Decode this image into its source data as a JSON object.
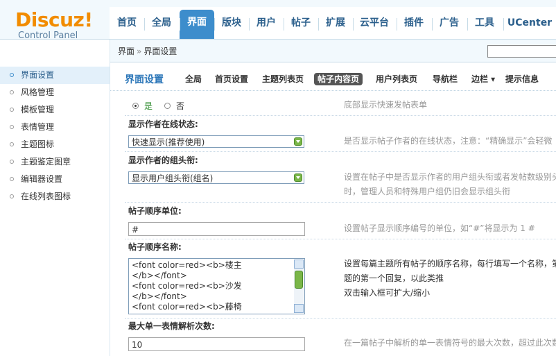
{
  "logo": {
    "brand": "Discuz!",
    "sub": "Control Panel"
  },
  "nav": [
    "首页",
    "全局",
    "界面",
    "版块",
    "用户",
    "帖子",
    "扩展",
    "云平台",
    "插件",
    "广告",
    "工具",
    "UCenter"
  ],
  "nav_active": "界面",
  "sidebar": [
    "界面设置",
    "风格管理",
    "模板管理",
    "表情管理",
    "主题图标",
    "主题鉴定图章",
    "编辑器设置",
    "在线列表图标"
  ],
  "sidebar_active": "界面设置",
  "breadcrumb": {
    "link": "界面",
    "sep": "»",
    "current": "界面设置"
  },
  "page_title": "界面设置",
  "tabs": [
    "全局",
    "首页设置",
    "主题列表页",
    "帖子内容页",
    "用户列表页",
    "导航栏",
    "边栏 ▾",
    "提示信息"
  ],
  "tab_active": "帖子内容页",
  "quickpost": {
    "yes": "是",
    "no": "否",
    "selected": "是",
    "desc": "底部显示快速发帖表单"
  },
  "online_status": {
    "label": "显示作者在线状态:",
    "value": "快速显示(推荐使用)",
    "desc": "是否显示帖子作者的在线状态，注意：“精确显示”会轻微"
  },
  "group_title": {
    "label": "显示作者的组头衔:",
    "value": "显示用户组头衔(组名)",
    "desc1": "设置在帖子中是否显示作者的用户组头衔或者发帖数级别头",
    "desc2": "时，管理人员和特殊用户组仍旧会显示组头衔"
  },
  "post_unit": {
    "label": "帖子顺序单位:",
    "value": "#",
    "desc": "设置帖子显示顺序编号的单位，如“#”将显示为 1 #"
  },
  "post_names": {
    "label": "帖子顺序名称:",
    "lines": [
      "<font color=red><b>楼主",
      "</b></font>",
      "<font color=red><b>沙发",
      "</b></font>",
      "<font color=red><b>藤椅"
    ],
    "desc1": "设置每篇主题所有帖子的顺序名称，每行填写一个名称，第",
    "desc2": "题的第一个回复，以此类推",
    "desc3": "双击输入框可扩大/缩小"
  },
  "smiley_max": {
    "label": "最大单一表情解析次数:",
    "value": "10",
    "desc": "在一篇帖子中解析的单一表情符号的最大次数，超过此次数"
  }
}
